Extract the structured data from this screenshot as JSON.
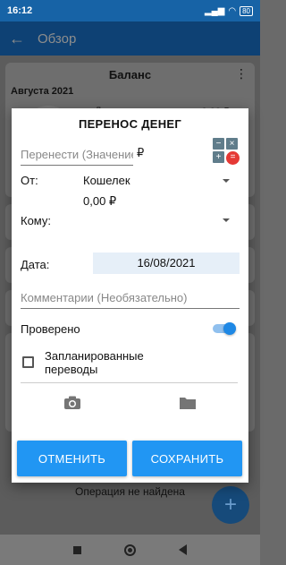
{
  "status_bar": {
    "time": "16:12",
    "battery": "80"
  },
  "app_bar": {
    "title": "Обзор"
  },
  "background": {
    "balance_title": "Баланс",
    "month": "Августа 2021",
    "income_label": "Доходы:",
    "income_value": "0,00 ₽",
    "not_found": "Операция не найдена",
    "fab_label": "+"
  },
  "dialog": {
    "title": "ПЕРЕНОС ДЕНЕГ",
    "amount_placeholder": "Перенести (Значение)",
    "currency": "₽",
    "from_label": "От:",
    "from_value": "Кошелек",
    "from_balance": "0,00 ₽",
    "to_label": "Кому:",
    "date_label": "Дата:",
    "date_value": "16/08/2021",
    "comment_placeholder": "Комментарии (Необязательно)",
    "checked_label": "Проверено",
    "checked_on": true,
    "scheduled_label": "Запланированные переводы",
    "cancel_label": "ОТМЕНИТЬ",
    "save_label": "СОХРАНИТЬ"
  },
  "colors": {
    "accent": "#2196f3",
    "toggle": "#1e88e5",
    "danger": "#e53935"
  }
}
